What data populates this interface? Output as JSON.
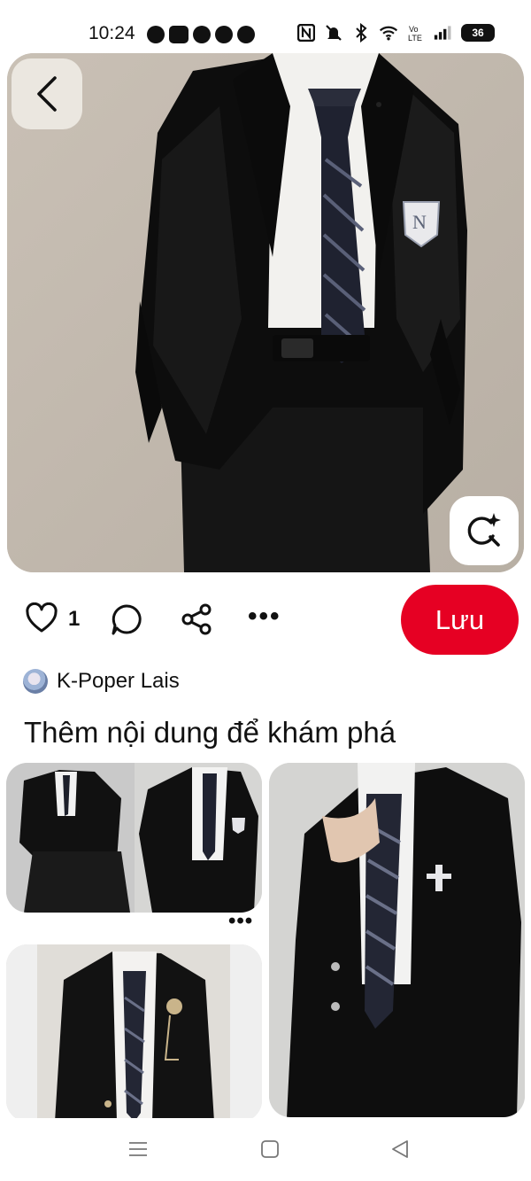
{
  "status_bar": {
    "time": "10:24",
    "battery": "36"
  },
  "pin": {
    "image_alt": "Áo blazer đen đồng phục với cà vạt sọc",
    "likes": "1",
    "save_label": "Lưu",
    "creator_name": "K-Poper Lais"
  },
  "related": {
    "title": "Thêm nội dung để khám phá",
    "more_label": "•••"
  },
  "icons": {
    "back": "chevron-left-icon",
    "lens": "visual-search-icon",
    "heart": "heart-icon",
    "comment": "comment-icon",
    "share": "share-icon",
    "more": "more-icon"
  },
  "colors": {
    "save_red": "#e60023",
    "hero_bg": "#c6beb3"
  }
}
